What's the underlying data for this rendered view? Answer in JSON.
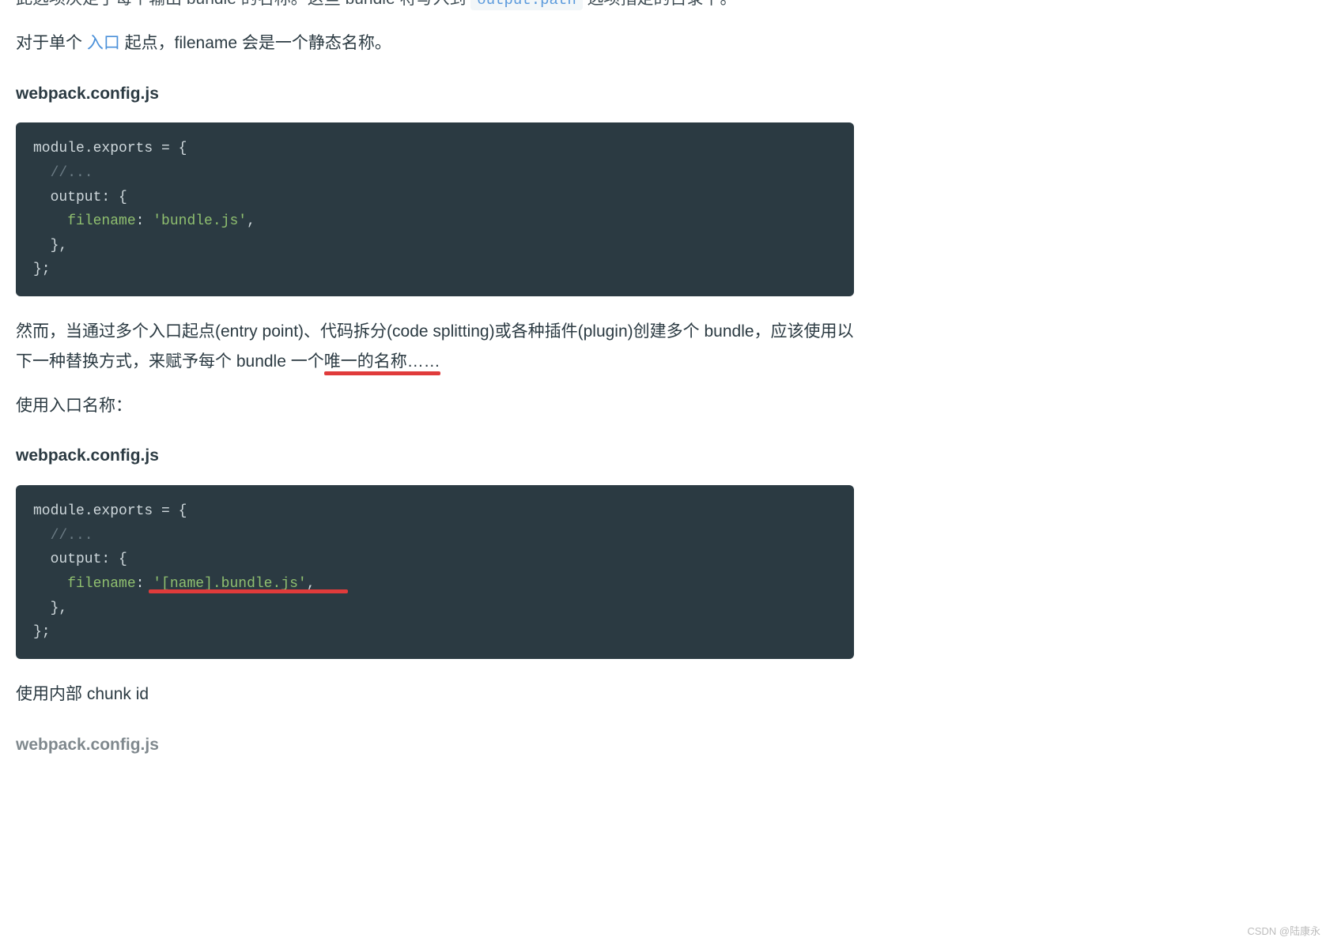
{
  "p0_partial_prefix": "此选项决定了每个输出 bundle 的名称。这些 bundle 将写入到 ",
  "p0_code": "output.path",
  "p0_partial_suffix": " 选项指定的目录下。",
  "p1_prefix": "对于单个 ",
  "p1_link": "入口",
  "p1_suffix": " 起点，filename 会是一个静态名称。",
  "h1": "webpack.config.js",
  "code1": {
    "l1a": "module",
    "l1b": ".exports ",
    "l1c": "=",
    "l1d": " {",
    "l2": "  //...",
    "l3a": "  output",
    "l3b": ":",
    "l3c": " {",
    "l4a": "    filename",
    "l4b": ":",
    "l4c": " ",
    "l4d": "'bundle.js'",
    "l4e": ",",
    "l5": "  },",
    "l6": "};"
  },
  "p2a": "然而，当通过多个入口起点(entry point)、代码拆分(code splitting)或各种插件(plugin)创建多个 bundle，应该使",
  "p2_u1": "用以下一种替换方式，",
  "p2b": "来赋予每个 bundle 一个",
  "p2_u2": "唯一的名称……",
  "p3": "使用入口名称：",
  "h2": "webpack.config.js",
  "code2": {
    "l1a": "module",
    "l1b": ".exports ",
    "l1c": "=",
    "l1d": " {",
    "l2": "  //...",
    "l3a": "  output",
    "l3b": ":",
    "l3c": " {",
    "l4a": "    filename",
    "l4b": ":",
    "l4c": " ",
    "l4d": "'[name].bundle.js'",
    "l4e": ",",
    "l5": "  },",
    "l6": "};"
  },
  "p4": "使用内部 chunk id",
  "h3": "webpack.config.js",
  "watermark": "CSDN @陆康永"
}
